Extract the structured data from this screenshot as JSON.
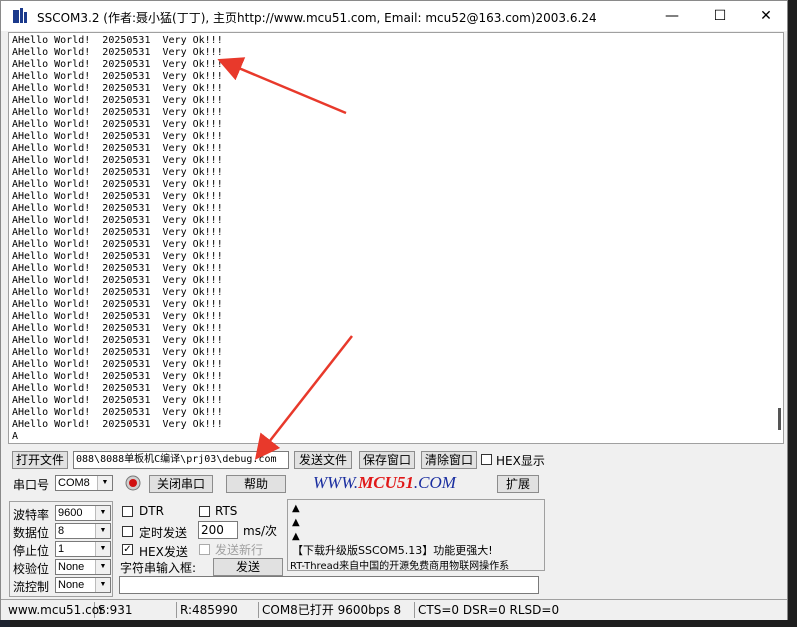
{
  "window": {
    "title": "SSCOM3.2 (作者:聂小猛(丁丁), 主页http://www.mcu51.com,  Email: mcu52@163.com)2003.6.24",
    "minimize": "—",
    "maximize": "☐",
    "close": "✕"
  },
  "receive": {
    "line_text": "AHello World!  20250531  Very Ok!!!",
    "line_count": 33,
    "last_line": "A"
  },
  "toolbar": {
    "open_file": "打开文件",
    "file_path": "088\\8088单板机C编译\\prj03\\debug.com",
    "send_file": "发送文件",
    "save_window": "保存窗口",
    "clear_window": "清除窗口",
    "hex_display": "HEX显示"
  },
  "port_row": {
    "port_label": "串口号",
    "port_value": "COM8",
    "close_port": "关闭串口",
    "help": "帮助",
    "brand_prefix": "WWW.",
    "brand_mid": "MCU51",
    "brand_suffix": ".COM",
    "expand": "扩展"
  },
  "settings": {
    "baud_label": "波特率",
    "baud_value": "9600",
    "databits_label": "数据位",
    "databits_value": "8",
    "stopbits_label": "停止位",
    "stopbits_value": "1",
    "parity_label": "校验位",
    "parity_value": "None",
    "flow_label": "流控制",
    "flow_value": "None"
  },
  "send": {
    "dtr": "DTR",
    "rts": "RTS",
    "timed_send": "定时发送",
    "interval_value": "200",
    "interval_unit": "ms/次",
    "hex_send": "HEX发送",
    "send_newline": "发送新行",
    "input_label": "字符串输入框:",
    "send_button": "发送"
  },
  "ad": {
    "line1": "【下载升级版SSCOM5.13】功能更强大!",
    "line2": "RT-Thread来自中国的开源免费商用物联网操作系"
  },
  "statusbar": {
    "site": "www.mcu51.cor",
    "sent": "S:931",
    "received": "R:485990",
    "port_state": "COM8已打开  9600bps  8",
    "signals": "CTS=0 DSR=0 RLSD=0"
  },
  "colors": {
    "arrow": "#e8392b",
    "brand": "#1a2ea0",
    "brand_accent": "#e01818"
  }
}
